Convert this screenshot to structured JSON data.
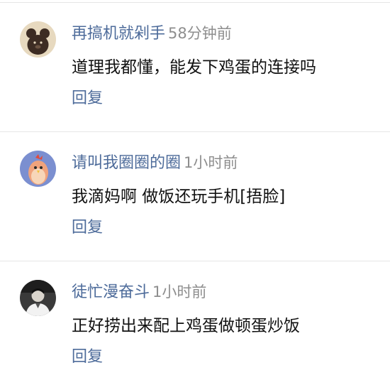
{
  "comments": [
    {
      "username": "再搞机就剁手",
      "time": "58分钟前",
      "content": "道理我都懂，能发下鸡蛋的连接吗",
      "reply_label": "回复",
      "avatar_icon": "bear-avatar-icon"
    },
    {
      "username": "请叫我圈圈的圈",
      "time": "1小时前",
      "content": "我滴妈啊 做饭还玩手机[捂脸]",
      "reply_label": "回复",
      "avatar_icon": "rooster-avatar-icon"
    },
    {
      "username": "徒忙漫奋斗",
      "time": "1小时前",
      "content": "正好捞出来配上鸡蛋做顿蛋炒饭",
      "reply_label": "回复",
      "avatar_icon": "person-avatar-icon"
    }
  ],
  "colors": {
    "link": "#4d6b9a",
    "time": "#8e8e8e",
    "text": "#111111",
    "divider": "#e6e6e6"
  }
}
